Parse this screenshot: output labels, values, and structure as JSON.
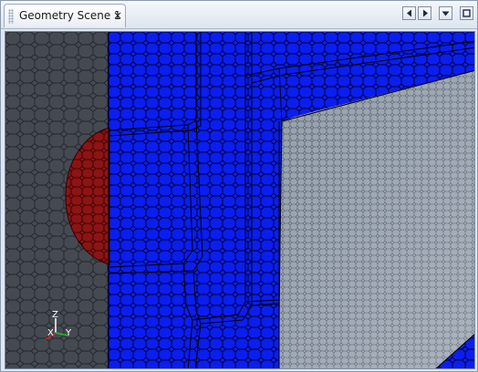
{
  "tab": {
    "title": "Geometry Scene 1",
    "close_glyph": "×"
  },
  "controls": [
    {
      "name": "scroll-tabs-left-button",
      "icon": "arrow-left-icon"
    },
    {
      "name": "scroll-tabs-right-button",
      "icon": "arrow-right-icon"
    },
    {
      "name": "tab-list-dropdown-button",
      "icon": "chevron-down-icon"
    },
    {
      "name": "maximize-button",
      "icon": "maximize-icon"
    }
  ],
  "triad": {
    "z_label": "Z",
    "x_label": "X",
    "y_label": "Y"
  },
  "colors": {
    "mesh_gray": "#454a52",
    "mesh_blue": "#0a1ef0",
    "mesh_red": "#8c1414",
    "mesh_light": "#8e9aa8",
    "edge_dark": "#000000"
  }
}
